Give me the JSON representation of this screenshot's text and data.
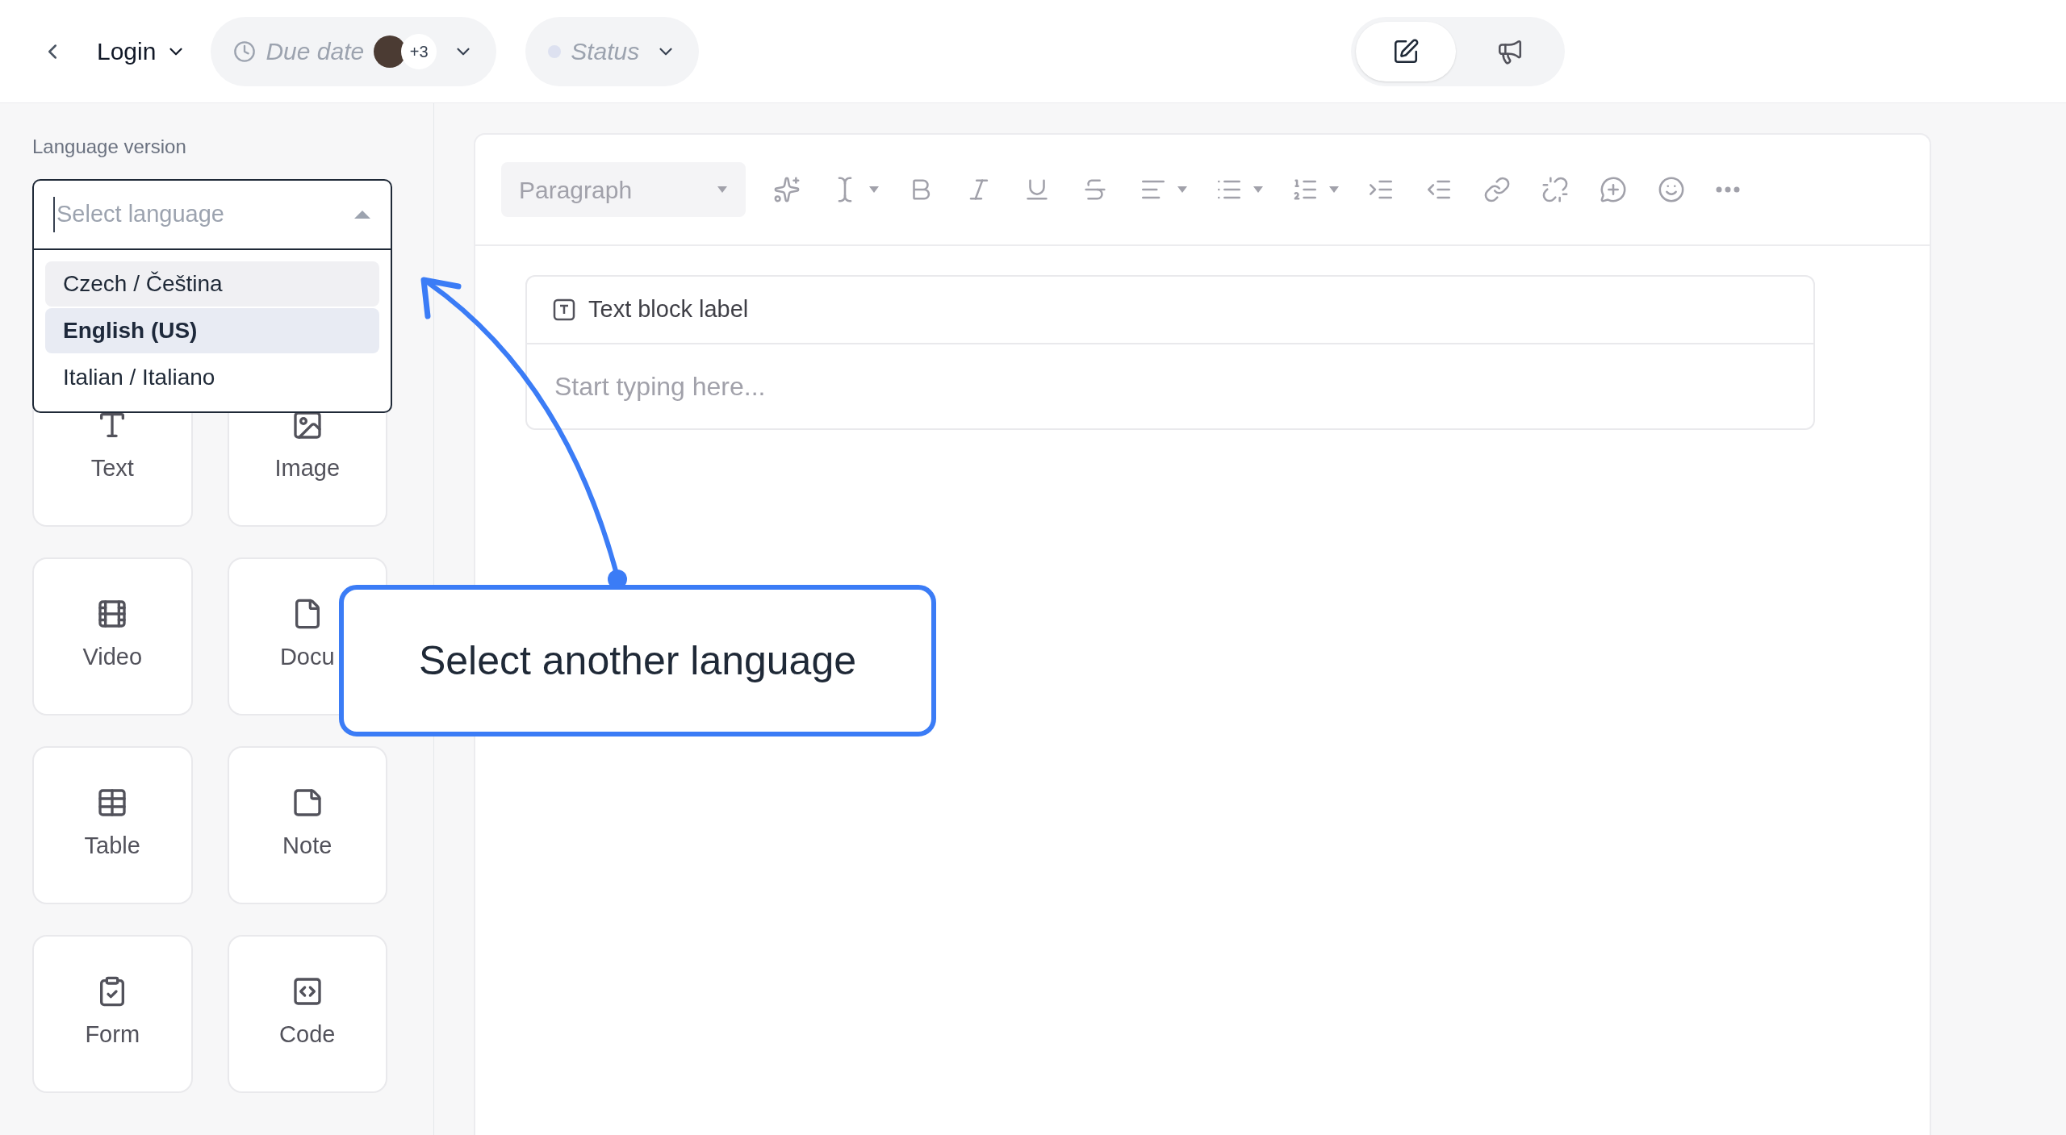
{
  "top_bar": {
    "breadcrumb": {
      "label": "Login"
    },
    "due_date": {
      "label": "Due date",
      "extra_count": "+3"
    },
    "status": {
      "label": "Status"
    },
    "view_toggle": [
      {
        "kind": "editor",
        "selected": true
      },
      {
        "kind": "announce",
        "selected": false
      }
    ]
  },
  "sidebar": {
    "title": "Language version",
    "language_select": {
      "placeholder": "Select language",
      "expanded": true,
      "options": [
        {
          "label": "Czech / Čeština",
          "selected": false,
          "highlighted": true
        },
        {
          "label": "English (US)",
          "selected": true,
          "highlighted": false
        },
        {
          "label": "Italian / Italiano",
          "selected": false,
          "highlighted": false
        }
      ]
    },
    "blocks": [
      {
        "kind": "text",
        "label": "Text"
      },
      {
        "kind": "image",
        "label": "Image"
      },
      {
        "kind": "video",
        "label": "Video"
      },
      {
        "kind": "document",
        "label": "Docu"
      },
      {
        "kind": "table",
        "label": "Table"
      },
      {
        "kind": "note",
        "label": "Note"
      },
      {
        "kind": "form",
        "label": "Form"
      },
      {
        "kind": "code",
        "label": "Code"
      }
    ]
  },
  "editor": {
    "toolbar": {
      "block_type": "Paragraph"
    },
    "text_block": {
      "label": "Text block label",
      "placeholder": "Start typing here..."
    }
  },
  "callout": {
    "text": "Select another language"
  }
}
